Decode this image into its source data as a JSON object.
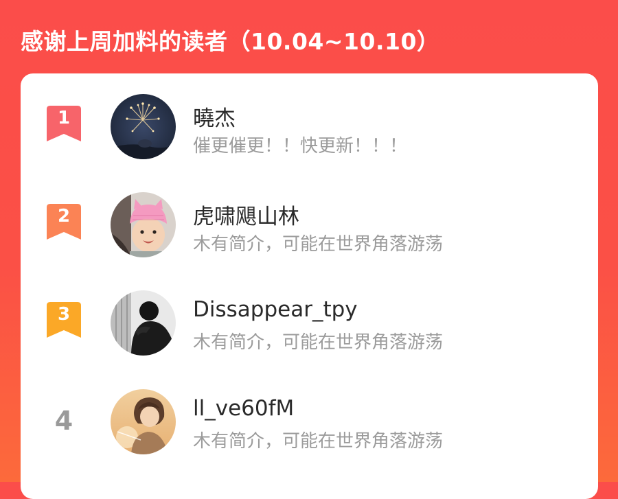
{
  "header": {
    "title": "感谢上周加料的读者（10.04~10.10）"
  },
  "readers": [
    {
      "rank": "1",
      "name": "曉杰",
      "bio": "催更催更！！快更新！！！",
      "badge_color": "#f7646a",
      "avatar_icon": "fireworks-photo-avatar"
    },
    {
      "rank": "2",
      "name": "虎啸飓山林",
      "bio": "木有简介，可能在世界角落游荡",
      "badge_color": "#fb8355",
      "avatar_icon": "baby-photo-avatar"
    },
    {
      "rank": "3",
      "name": "Dissappear_tpy",
      "bio": "木有简介，可能在世界角落游荡",
      "badge_color": "#fba827",
      "avatar_icon": "silhouette-photo-avatar"
    },
    {
      "rank": "4",
      "name": "ll_ve60fM",
      "bio": "木有简介，可能在世界角落游荡",
      "avatar_icon": "anime-girl-avatar"
    }
  ]
}
